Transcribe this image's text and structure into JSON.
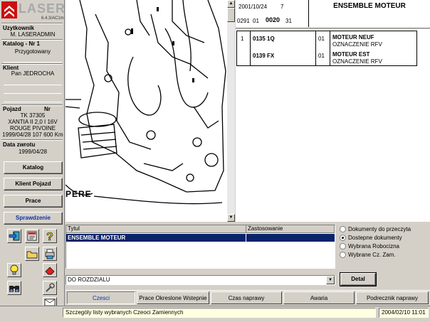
{
  "app": {
    "logo_text": "LASER",
    "version": "6.4.3/AC1m"
  },
  "sidebar": {
    "user_label": "Uzytkownik",
    "user_value": "M. LASERADMIN",
    "catalog_label": "Katalog - Nr 1",
    "catalog_value": "Przygotowany",
    "client_label": "Klient",
    "client_value": "Pan JEDROCHA",
    "vehicle_label": "Pojazd",
    "vehicle_nr_label": "Nr",
    "vehicle_reg": "TK 37305",
    "vehicle_model": "XANTIA II 2,0 I 16V",
    "vehicle_color": "ROUGE PIVOINE",
    "vehicle_date_km": "1999/04/28  107 600 Km",
    "return_label": "Data zwrotu",
    "return_value": "1999/04/28",
    "buttons": [
      "Katalog",
      "Klient Pojazd",
      "Prace",
      "Sprawdzenie"
    ]
  },
  "drawing": {
    "caption": "PERE"
  },
  "header": {
    "date": "2001/10/24",
    "code_7": "7",
    "code_0291": "0291",
    "code_01": "01",
    "code_0020": "0020",
    "code_31": "31",
    "part_title": "ENSEMBLE MOTEUR"
  },
  "parts": [
    {
      "index": "1",
      "ref": "0135 1Q",
      "qty": "01",
      "name": "MOTEUR NEUF",
      "sub": "OZNACZENIE RFV"
    },
    {
      "index": "",
      "ref": "0139 FX",
      "qty": "01",
      "name": "MOTEUR EST",
      "sub": "OZNACZENIE RFV"
    }
  ],
  "grid": {
    "col_title": "Tytul",
    "col_usage": "Zastosowanie",
    "row_title": "ENSEMBLE MOTEUR",
    "row_usage": ""
  },
  "select": {
    "value": "DO ROZDZIALU"
  },
  "radios": [
    {
      "label": "Dokumenty do przeczyta",
      "selected": false
    },
    {
      "label": "Dostepne dokumenty",
      "selected": true
    },
    {
      "label": "Wybrana Robocizna",
      "selected": false
    },
    {
      "label": "Wybrane Cz. Zam.",
      "selected": false
    }
  ],
  "detal_label": "Detal",
  "tabs": [
    "Czesci",
    "Prace Okreslone Wstepnie",
    "Czas naprawy",
    "Awaria",
    "Podrecznik naprawy"
  ],
  "status": {
    "message": "Szczególy listy wybranych Czeoci Zamiennych",
    "datetime": "2004/02/10   11:01"
  },
  "colors": {
    "selection": "#0a246a",
    "link_blue": "#1030a8",
    "status_bg": "#ffffe1",
    "logo_red": "#cc1010"
  }
}
